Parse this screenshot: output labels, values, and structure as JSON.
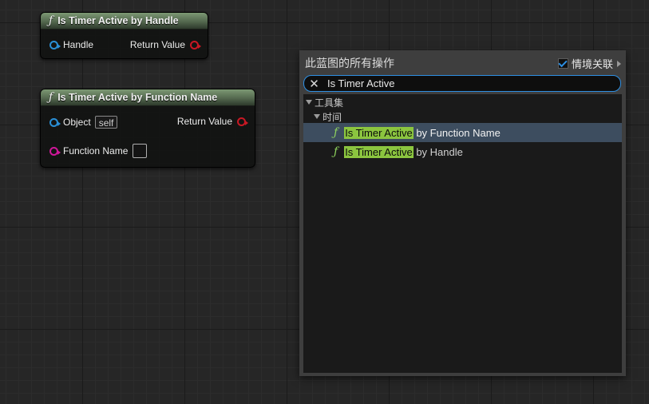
{
  "nodes": [
    {
      "title": "Is Timer Active by Handle",
      "pins": {
        "input_1": "Handle",
        "output": "Return Value"
      }
    },
    {
      "title": "Is Timer Active by Function Name",
      "pins": {
        "input_1": "Object",
        "input_1_default": "self",
        "input_2": "Function Name",
        "output": "Return Value"
      }
    }
  ],
  "menu": {
    "title": "此蓝图的所有操作",
    "context_sensitive_label": "情境关联",
    "context_sensitive_checked": true,
    "search": {
      "value": "Is Timer Active",
      "clear_icon": "close-icon"
    },
    "categories": [
      {
        "label": "工具集",
        "expanded": true
      },
      {
        "label": "时间",
        "expanded": true
      }
    ],
    "results": [
      {
        "highlight": "Is Timer Active",
        "rest": " by Function Name",
        "selected": true
      },
      {
        "highlight": "Is Timer Active",
        "rest": " by Handle",
        "selected": false
      }
    ]
  },
  "colors": {
    "pin_object": "#2a8fd6",
    "pin_bool": "#c81824",
    "pin_name": "#d0179a",
    "search_highlight": "#8bc53f",
    "selection": "#3d4d5f",
    "focus_border": "#2d8fe3"
  }
}
